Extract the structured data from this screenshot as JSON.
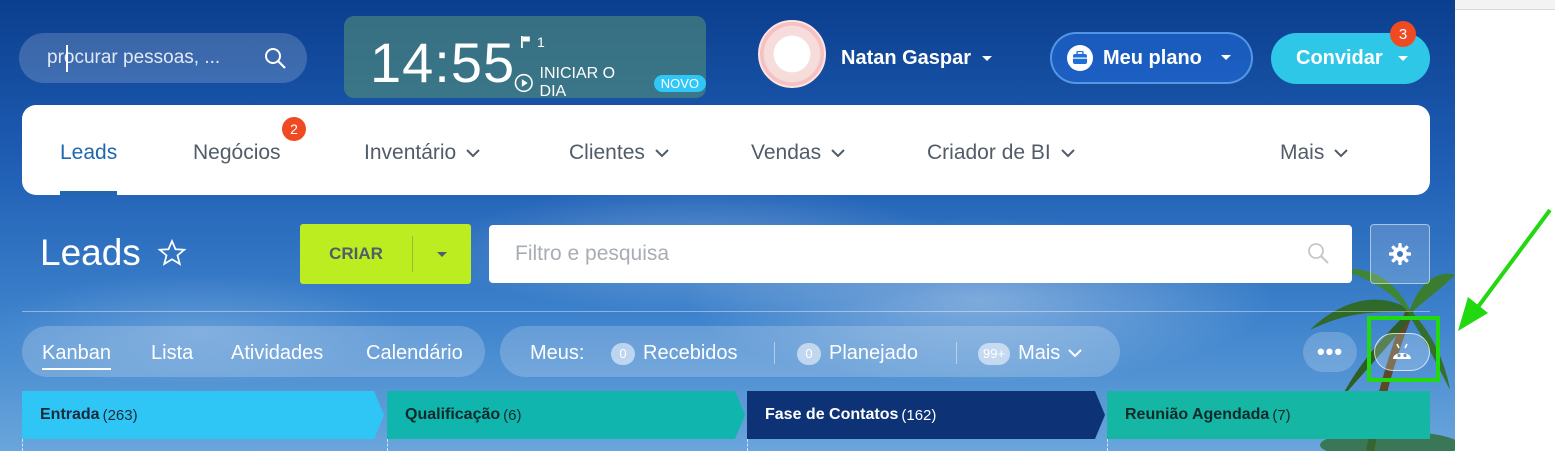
{
  "header": {
    "search_placeholder": "procurar pessoas, ...",
    "clock": {
      "time": "14:55",
      "flag_count": "1",
      "start_day_label": "INICIAR O DIA",
      "new_badge": "NOVO"
    },
    "user_name": "Natan Gaspar",
    "plan_button": "Meu plano",
    "invite_button": "Convidar",
    "invite_badge": "3"
  },
  "nav": {
    "items": [
      {
        "label": "Leads",
        "active": true
      },
      {
        "label": "Negócios",
        "badge": "2"
      },
      {
        "label": "Inventário",
        "dropdown": true
      },
      {
        "label": "Clientes",
        "dropdown": true
      },
      {
        "label": "Vendas",
        "dropdown": true
      },
      {
        "label": "Criador de BI",
        "dropdown": true
      },
      {
        "label": "Mais",
        "dropdown": true
      }
    ]
  },
  "toolbar": {
    "page_title": "Leads",
    "create_button": "CRIAR",
    "filter_placeholder": "Filtro e pesquisa"
  },
  "views": {
    "tabs": [
      "Kanban",
      "Lista",
      "Atividades",
      "Calendário"
    ],
    "active": "Kanban"
  },
  "counters": {
    "label": "Meus:",
    "items": [
      {
        "count": "0",
        "label": "Recebidos"
      },
      {
        "count": "0",
        "label": "Planejado"
      },
      {
        "count": "99+",
        "label": "Mais"
      }
    ]
  },
  "stages": [
    {
      "name": "Entrada",
      "count": "(263)",
      "color": "#2fc6f6",
      "text_color": "#1a2a3a"
    },
    {
      "name": "Qualificação",
      "count": "(6)",
      "color": "#10b5ad",
      "text_color": "#0f2a2a"
    },
    {
      "name": "Fase de Contatos",
      "count": "(162)",
      "color": "#0d3275",
      "text_color": "#ffffff"
    },
    {
      "name": "Reunião Agendada",
      "count": "(7)",
      "color": "#16b6a4",
      "text_color": "#0f2a2a"
    }
  ],
  "colors": {
    "accent_blue": "#2067b0",
    "create_green": "#bbed21",
    "invite_cyan": "#2fc7e8",
    "badge_red": "#f04a23",
    "highlight_green": "#22d80f"
  }
}
